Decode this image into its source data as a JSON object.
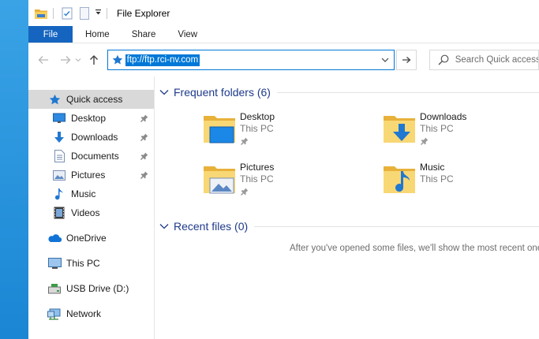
{
  "window": {
    "title": "File Explorer"
  },
  "ribbon": {
    "tabs": [
      "File",
      "Home",
      "Share",
      "View"
    ]
  },
  "address": {
    "value": "ftp://ftp.rci-nv.com"
  },
  "search": {
    "placeholder": "Search Quick access"
  },
  "sidebar": {
    "items": [
      {
        "label": "Quick access",
        "icon": "star-icon",
        "selected": true
      },
      {
        "label": "Desktop",
        "icon": "desktop-icon",
        "pinned": true
      },
      {
        "label": "Downloads",
        "icon": "download-icon",
        "pinned": true
      },
      {
        "label": "Documents",
        "icon": "documents-icon",
        "pinned": true
      },
      {
        "label": "Pictures",
        "icon": "pictures-icon",
        "pinned": true
      },
      {
        "label": "Music",
        "icon": "music-icon"
      },
      {
        "label": "Videos",
        "icon": "videos-icon"
      },
      {
        "label": "OneDrive",
        "icon": "cloud-icon"
      },
      {
        "label": "This PC",
        "icon": "computer-icon"
      },
      {
        "label": "USB Drive (D:)",
        "icon": "usb-drive-icon"
      },
      {
        "label": "Network",
        "icon": "network-icon"
      }
    ]
  },
  "content": {
    "frequent_header": "Frequent folders (6)",
    "recent_header": "Recent files (0)",
    "folders": [
      {
        "name": "Desktop",
        "location": "This PC",
        "icon": "desktop-folder-icon",
        "pinned": true
      },
      {
        "name": "Downloads",
        "location": "This PC",
        "icon": "downloads-folder-icon",
        "pinned": true
      },
      {
        "name": "Pictures",
        "location": "This PC",
        "icon": "pictures-folder-icon",
        "pinned": true
      },
      {
        "name": "Music",
        "location": "This PC",
        "icon": "music-folder-icon",
        "pinned": false
      }
    ],
    "empty_message": "After you've opened some files, we'll show the most recent ones here."
  },
  "colors": {
    "accent": "#0078d7",
    "file_tab": "#1565c0",
    "header_text": "#1e3a8a",
    "selection": "#d9d9d9"
  }
}
